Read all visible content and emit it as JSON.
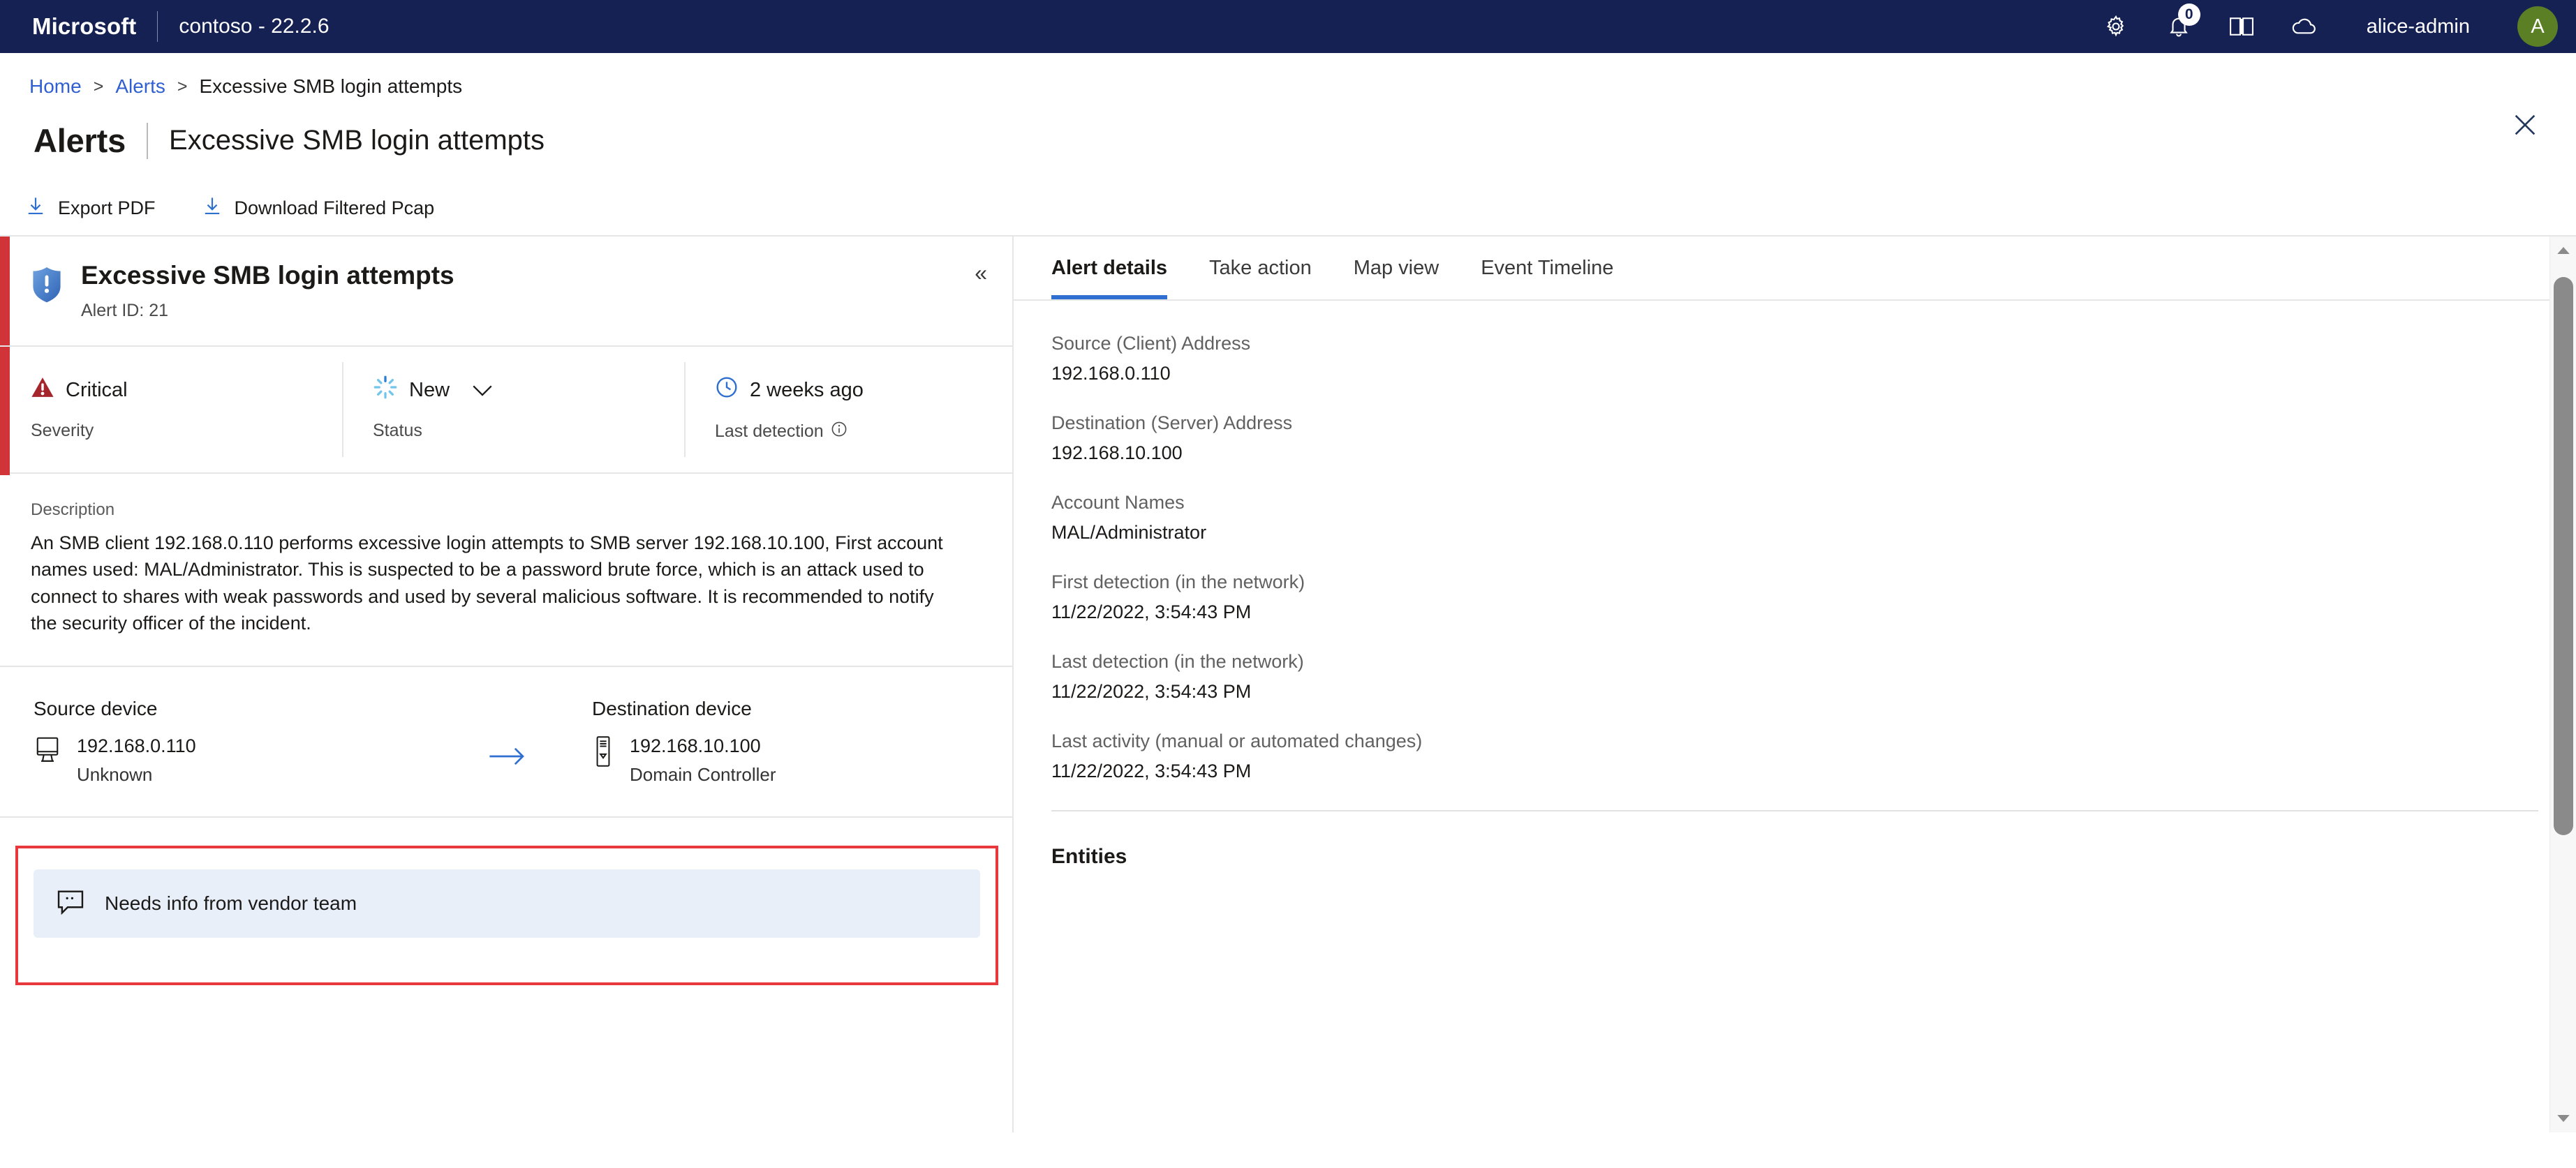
{
  "topbar": {
    "brand": "Microsoft",
    "tenant": "contoso - 22.2.6",
    "icons": [
      {
        "name": "gear-icon",
        "label": "Settings"
      },
      {
        "name": "bell-icon",
        "label": "Notifications"
      },
      {
        "name": "book-icon",
        "label": "Documentation"
      },
      {
        "name": "cloud-icon",
        "label": "Cloud connection"
      }
    ],
    "notification_count": "0",
    "username": "alice-admin",
    "avatar_initial": "A",
    "avatar_color": "#5b7f24",
    "background_color": "#152152"
  },
  "breadcrumb": {
    "home": "Home",
    "alerts": "Alerts",
    "current": "Excessive SMB login attempts",
    "separator": ">"
  },
  "page": {
    "title": "Alerts",
    "subtitle": "Excessive SMB login attempts",
    "close_label": "Close"
  },
  "commandbar": {
    "export_pdf": "Export PDF",
    "download_pcap": "Download Filtered Pcap"
  },
  "alert_card": {
    "title": "Excessive SMB login attempts",
    "alert_id": "Alert ID: 21",
    "collapse_label": "«",
    "severity": {
      "value": "Critical",
      "label": "Severity",
      "color": "#a4262c"
    },
    "status": {
      "value": "New",
      "label": "Status",
      "color": "#69c0eb"
    },
    "last_detection": {
      "value": "2 weeks ago",
      "label": "Last detection",
      "color": "#2f6fd0"
    },
    "description": {
      "label": "Description",
      "text": "An SMB client 192.168.0.110 performs excessive login attempts to SMB server 192.168.10.100, First account names used: MAL/Administrator. This is suspected to be a password brute force, which is an attack used to connect to shares with weak passwords and used by several malicious software. It is recommended to notify the security officer of the incident."
    },
    "source_device": {
      "heading": "Source device",
      "ip": "192.168.0.110",
      "type": "Unknown"
    },
    "destination_device": {
      "heading": "Destination device",
      "ip": "192.168.10.100",
      "type": "Domain Controller"
    },
    "comment": {
      "text": "Needs info from vendor team",
      "highlight_color": "#e8383d",
      "background_color": "#e9eff9"
    }
  },
  "right_panel": {
    "tabs": [
      {
        "label": "Alert details",
        "active": true
      },
      {
        "label": "Take action",
        "active": false
      },
      {
        "label": "Map view",
        "active": false
      },
      {
        "label": "Event Timeline",
        "active": false
      }
    ],
    "fields": [
      {
        "label": "Source (Client) Address",
        "value": "192.168.0.110"
      },
      {
        "label": "Destination (Server) Address",
        "value": "192.168.10.100"
      },
      {
        "label": "Account Names",
        "value": "MAL/Administrator"
      },
      {
        "label": "First detection (in the network)",
        "value": "11/22/2022, 3:54:43 PM"
      },
      {
        "label": "Last detection (in the network)",
        "value": "11/22/2022, 3:54:43 PM"
      },
      {
        "label": "Last activity (manual or automated changes)",
        "value": "11/22/2022, 3:54:43 PM"
      }
    ],
    "entities_heading": "Entities"
  }
}
